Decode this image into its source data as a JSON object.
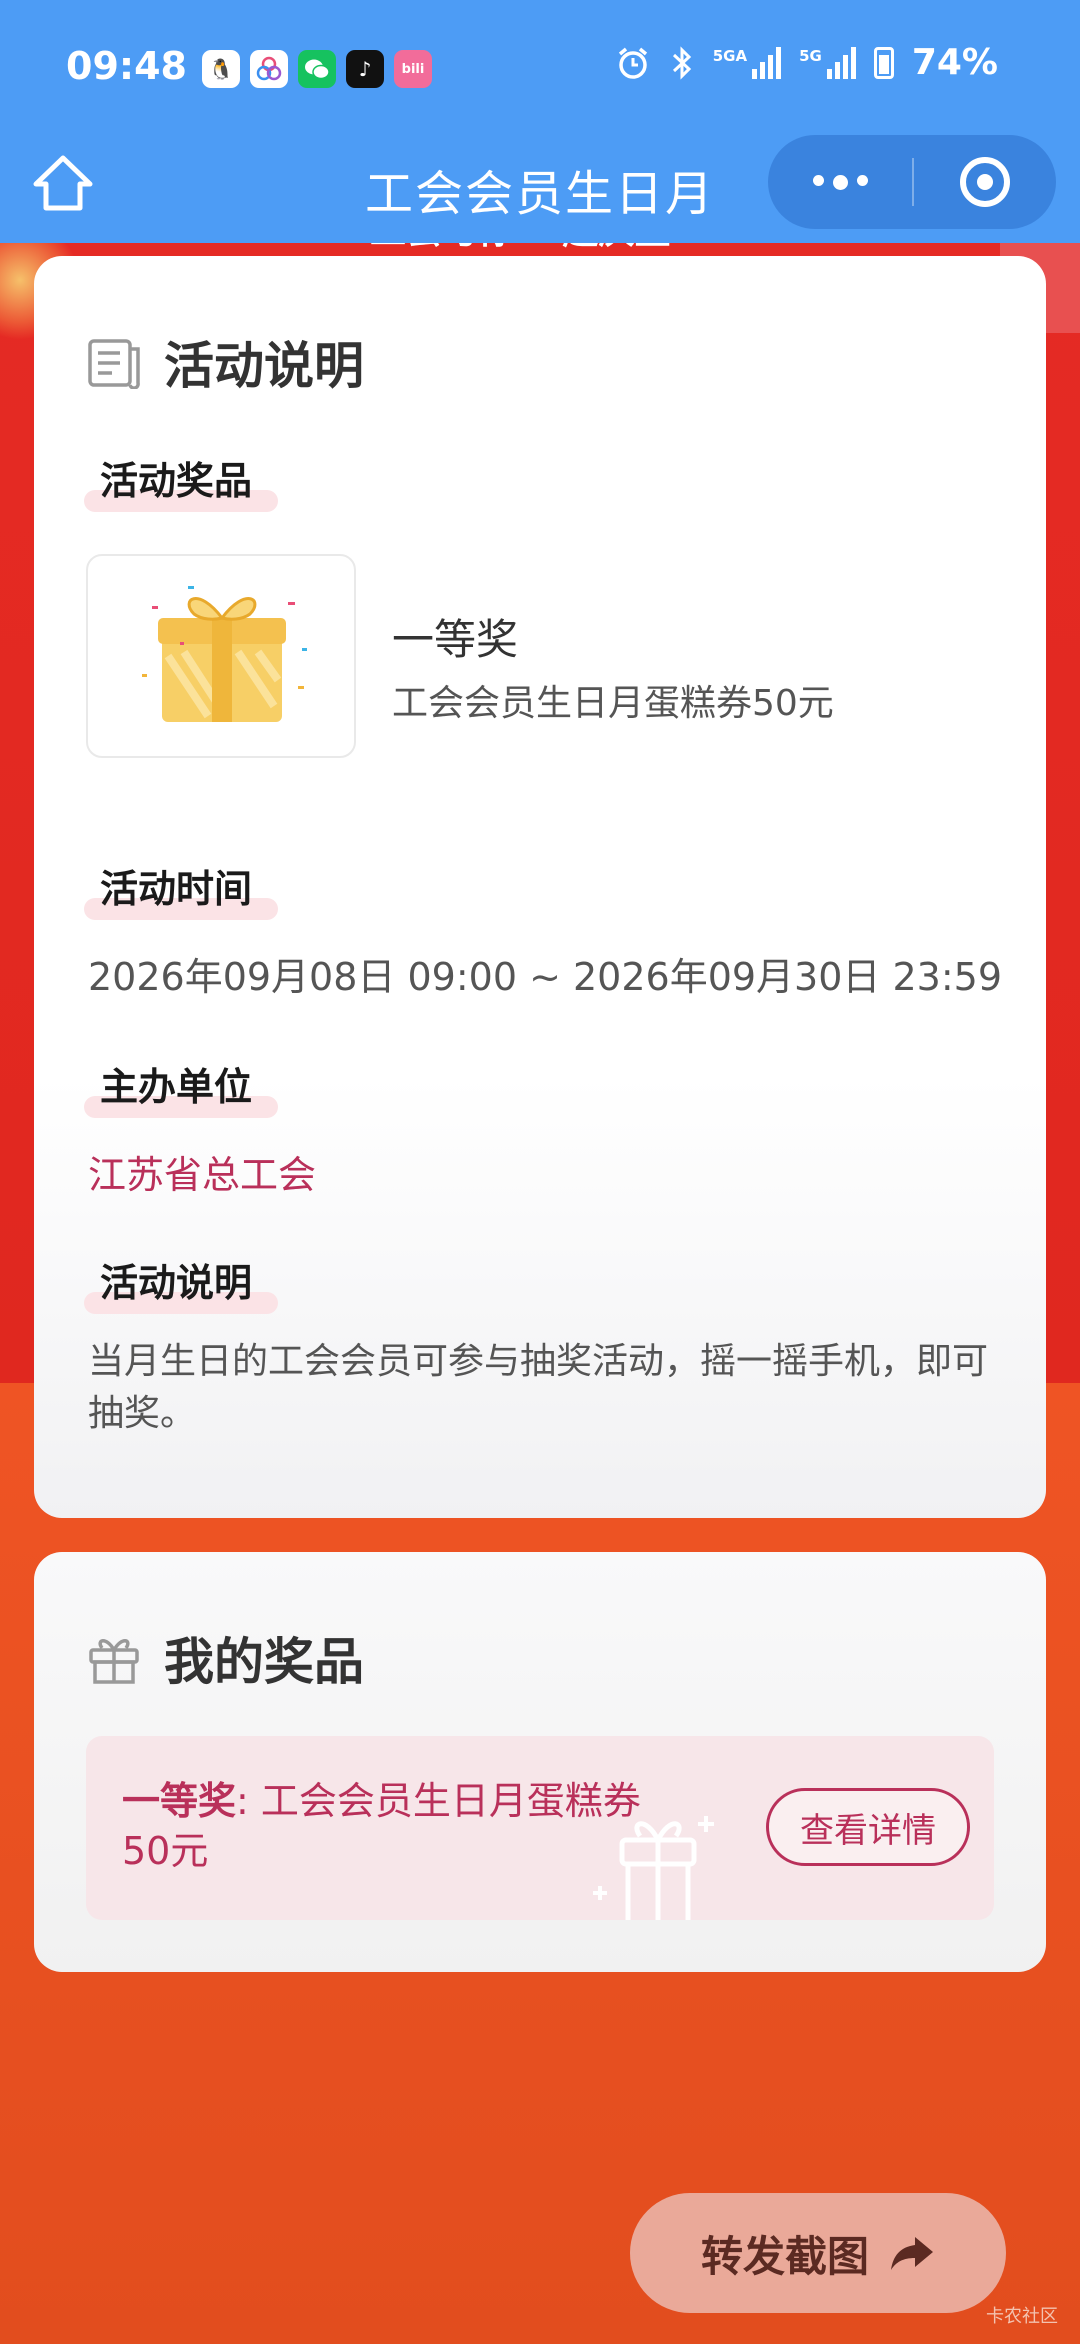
{
  "status_bar": {
    "time": "09:48",
    "signal_1": "5GA",
    "signal_2": "5G",
    "battery": "74%"
  },
  "header": {
    "title": "工会会员生日月",
    "peek_text": "工会与你 一起庆生"
  },
  "activity_card": {
    "heading": "活动说明",
    "prize_section": {
      "label": "活动奖品",
      "rank": "一等奖",
      "name": "工会会员生日月蛋糕券50元"
    },
    "time_section": {
      "label": "活动时间",
      "value": "2026年09月08日 09:00 ~ 2026年09月30日 23:59"
    },
    "organizer_section": {
      "label": "主办单位",
      "value": "江苏省总工会"
    },
    "description_section": {
      "label": "活动说明",
      "value": "当月生日的工会会员可参与抽奖活动，摇一摇手机，即可抽奖。"
    }
  },
  "my_prize_card": {
    "heading": "我的奖品",
    "award_rank": "一等奖",
    "award_text": ": 工会会员生日月蛋糕券50元",
    "detail_button": "查看详情"
  },
  "share_button": "转发截图",
  "watermark": "卡农社区",
  "colors": {
    "nav_blue": "#4d9cf5",
    "accent_red": "#b9305a",
    "page_red": "#e52a24",
    "page_orange": "#ef5424"
  }
}
